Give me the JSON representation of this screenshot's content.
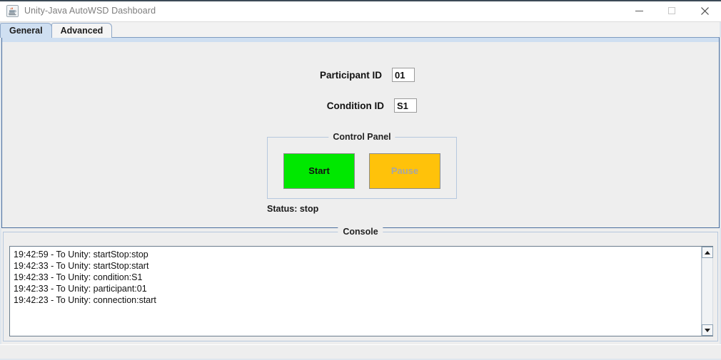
{
  "window": {
    "title": "Unity-Java AutoWSD Dashboard",
    "icon": "java-coffee-cup-icon",
    "controls": {
      "minimize_label": "Minimize",
      "maximize_label": "Maximize",
      "close_label": "Close"
    }
  },
  "tabs": [
    {
      "label": "General",
      "active": true
    },
    {
      "label": "Advanced",
      "active": false
    }
  ],
  "general_tab": {
    "fields": [
      {
        "label": "Participant ID",
        "value": "01",
        "placeholder": ""
      },
      {
        "label": "Condition ID",
        "value": "S1",
        "placeholder": ""
      }
    ],
    "control_panel": {
      "title": "Control Panel",
      "buttons": [
        {
          "label": "Start",
          "color": "#00E800",
          "text_color": "#111111",
          "enabled": true
        },
        {
          "label": "Pause",
          "color": "#FFC20A",
          "text_color": "#a6a6a6",
          "enabled": false
        }
      ]
    },
    "status": {
      "text": "Status: stop",
      "value": "stop"
    }
  },
  "console": {
    "title": "Console",
    "lines": [
      "19:42:59 - To Unity: startStop:stop",
      "19:42:33 - To Unity: startStop:start",
      "19:42:33 - To Unity: condition:S1",
      "19:42:33 - To Unity: participant:01",
      "19:42:23 - To Unity: connection:start"
    ],
    "scrollbar": {
      "up_arrow": "scroll-up-icon",
      "down_arrow": "scroll-down-icon"
    }
  },
  "colors": {
    "panel_background": "#eeeeee",
    "titlebar_background": "#ffffff",
    "tab_active": "#cfdff1",
    "border_blue": "#4a6e9e",
    "start_green": "#00E800",
    "pause_amber": "#FFC20A"
  }
}
